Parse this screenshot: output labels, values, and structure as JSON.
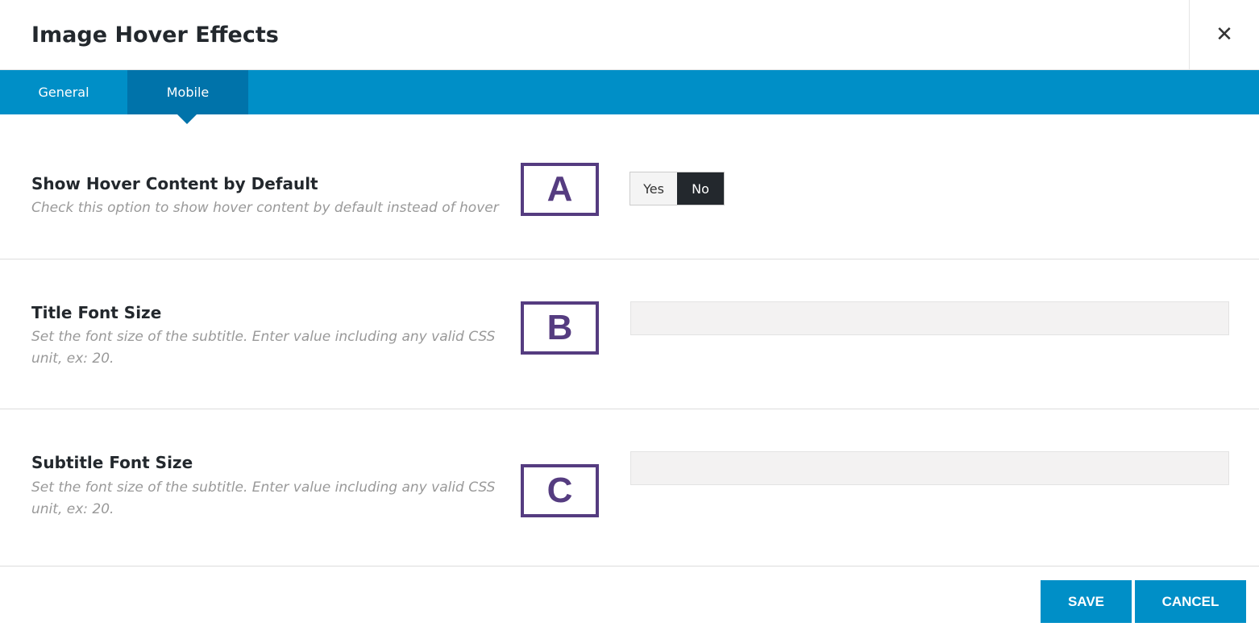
{
  "header": {
    "title": "Image Hover Effects",
    "close_icon": "close-icon"
  },
  "tabs": [
    {
      "label": "General",
      "active": false
    },
    {
      "label": "Mobile",
      "active": true
    }
  ],
  "fields": [
    {
      "label": "Show Hover Content by Default",
      "description": "Check this option to show hover content by default instead of hover",
      "marker": "A",
      "type": "toggle",
      "options": [
        "Yes",
        "No"
      ],
      "selected": "No"
    },
    {
      "label": "Title Font Size",
      "description": "Set the font size of the subtitle. Enter value including any valid CSS unit, ex: 20.",
      "marker": "B",
      "type": "text",
      "value": ""
    },
    {
      "label": "Subtitle Font Size",
      "description": "Set the font size of the subtitle. Enter value including any valid CSS unit, ex: 20.",
      "marker": "C",
      "type": "text",
      "value": ""
    }
  ],
  "footer": {
    "save_label": "SAVE",
    "cancel_label": "CANCEL"
  },
  "colors": {
    "accent": "#008fc7",
    "active_tab": "#0073aa",
    "marker": "#553c80"
  }
}
